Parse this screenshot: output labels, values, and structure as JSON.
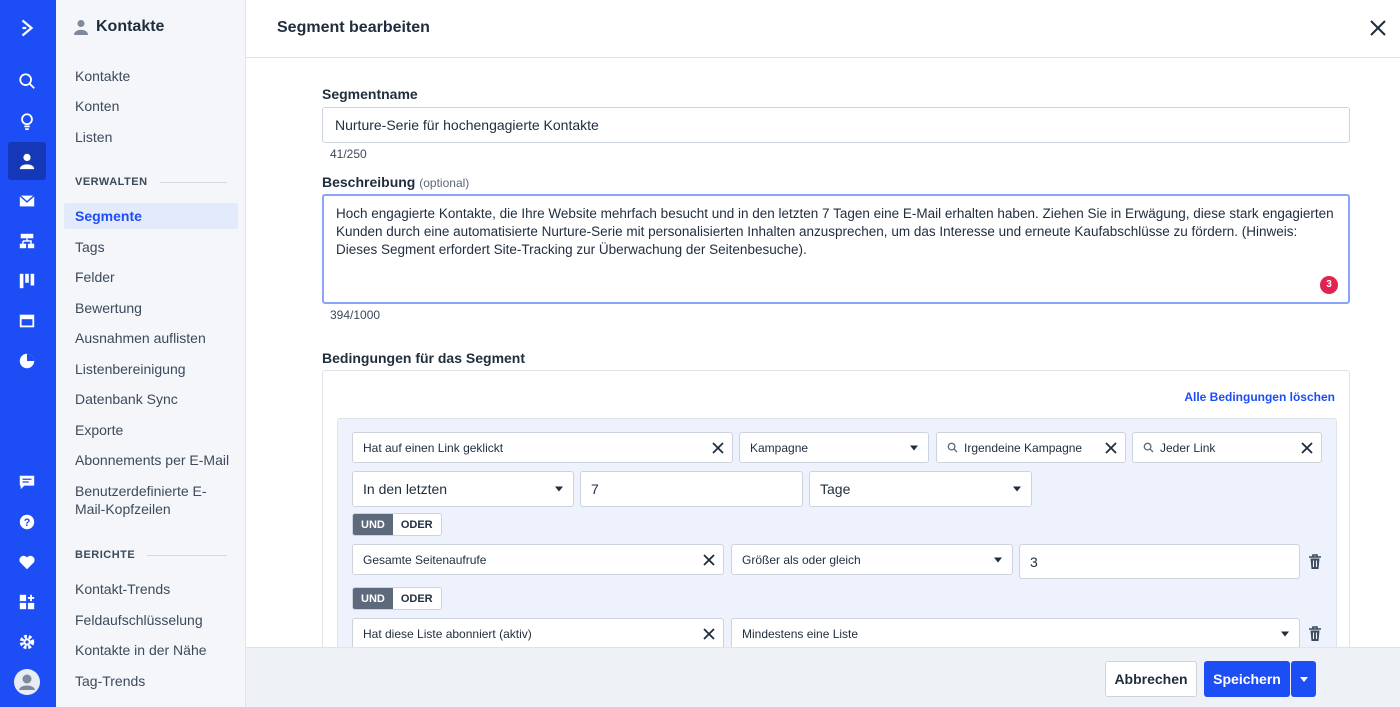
{
  "sidebar": {
    "header": "Kontakte",
    "top_items": [
      "Kontakte",
      "Konten",
      "Listen"
    ],
    "manage_title": "VERWALTEN",
    "manage_items": [
      "Segmente",
      "Tags",
      "Felder",
      "Bewertung",
      "Ausnahmen auflisten",
      "Listenbereinigung",
      "Datenbank Sync",
      "Exporte",
      "Abonnements per E-Mail",
      "Benutzerdefinierte E-",
      "Mail-Kopfzeilen"
    ],
    "reports_title": "BERICHTE",
    "report_items": [
      "Kontakt-Trends",
      "Feldaufschlüsselung",
      "Kontakte in der Nähe",
      "Tag-Trends"
    ]
  },
  "rail": {
    "icons": [
      "logo-icon",
      "search-icon",
      "lightbulb-icon",
      "contacts-icon",
      "email-icon",
      "automation-icon",
      "deals-icon",
      "site-icon",
      "reports-icon",
      "chat-icon",
      "help-icon",
      "heart-icon",
      "apps-icon",
      "settings-icon",
      "profile-icon"
    ],
    "accent": "#1d4ef5"
  },
  "header": {
    "title": "Segment bearbeiten"
  },
  "form": {
    "name_label": "Segmentname",
    "name_value": "Nurture-Serie für hochengagierte Kontakte",
    "name_count": "41/250",
    "desc_label": "Beschreibung",
    "desc_optional": "(optional)",
    "desc_value": "Hoch engagierte Kontakte, die Ihre Website mehrfach besucht und in den letzten 7 Tagen eine E-Mail erhalten haben. Ziehen Sie in Erwägung, diese stark engagierten Kunden durch eine automatisierte Nurture-Serie mit personalisierten Inhalten anzusprechen, um das Interesse und erneute Kaufabschlüsse zu fördern. (Hinweis: Dieses Segment erfordert Site-Tracking zur Überwachung der Seitenbesuche).",
    "desc_badge": "3",
    "desc_count": "394/1000"
  },
  "conditions": {
    "title": "Bedingungen für das Segment",
    "clear_label": "Alle Bedingungen löschen",
    "row1": {
      "field": "Hat auf einen Link geklickt",
      "campaign_select": "Kampagne",
      "campaign_search": "Irgendeine Kampagne",
      "link_search": "Jeder Link",
      "period_select": "In den letzten",
      "period_value": "7",
      "unit_select": "Tage"
    },
    "logic1": {
      "and": "UND",
      "or": "ODER"
    },
    "row2": {
      "field": "Gesamte Seitenaufrufe",
      "operator": "Größer als oder gleich",
      "value": "3"
    },
    "logic2": {
      "and": "UND",
      "or": "ODER"
    },
    "row3": {
      "field": "Hat diese Liste abonniert (aktiv)",
      "operator": "Mindestens eine Liste"
    }
  },
  "footer": {
    "cancel": "Abbrechen",
    "save": "Speichern"
  }
}
